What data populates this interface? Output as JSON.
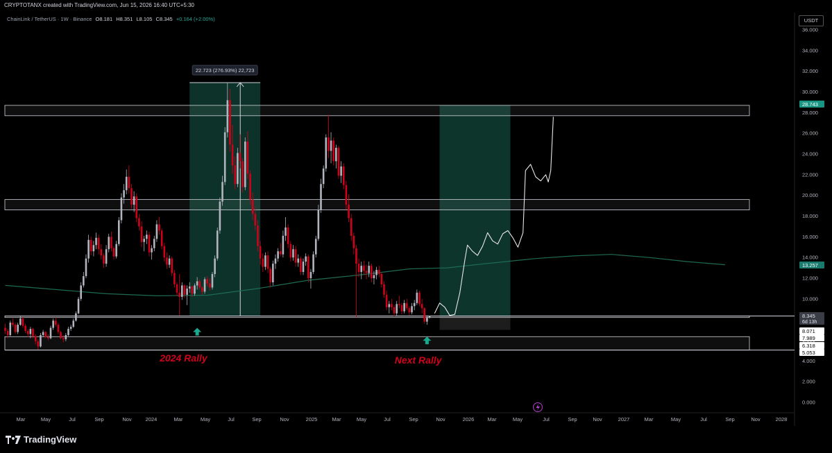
{
  "header": {
    "credit": "CRYPTOTANX created with TradingView.com, Jun 15, 2026 16:40 UTC+5:30"
  },
  "legend": {
    "symbol_line": "ChainLink / TetherUS · 1W · Binance",
    "open": "O8.181",
    "high": "H8.351",
    "low": "L8.105",
    "close": "C8.345",
    "change": "+0.164 (+2.00%)"
  },
  "currency_badge": "USDT",
  "colors": {
    "background": "#000000",
    "up_candle": "#b2b5be",
    "down_candle": "#d0021b",
    "ma_line": "#1e6b55",
    "zone_fill": "#0f3b30",
    "zone_box_stroke": "#d1d4dc",
    "rally_text": "#d0021b",
    "arrow": "#19a98e",
    "price_tag_green": "#199683",
    "price_tag_teal": "#1a7a6d",
    "forecast_path": "#e8e8e8"
  },
  "footer": {
    "brand": "TradingView",
    "logo": "tradingview-logo-icon"
  },
  "chart_data": {
    "type": "candlestick",
    "title": "ChainLink / TetherUS · 1W · Binance",
    "ylim": [
      0,
      36
    ],
    "y_ticks": [
      "36.000",
      "34.000",
      "32.000",
      "30.000",
      "28.000",
      "26.000",
      "24.000",
      "22.000",
      "20.000",
      "18.000",
      "16.000",
      "14.000",
      "12.000",
      "10.000",
      "8.000",
      "6.000",
      "4.000",
      "2.000",
      "0.000"
    ],
    "x_ticks": [
      "Mar",
      "May",
      "Jul",
      "Sep",
      "Nov",
      "2024",
      "Mar",
      "May",
      "Jul",
      "Sep",
      "Nov",
      "2025",
      "Mar",
      "May",
      "Jul",
      "Sep",
      "Nov",
      "2026",
      "Mar",
      "May",
      "Jul",
      "Sep",
      "Nov",
      "2027",
      "Mar",
      "May",
      "Jul",
      "Sep",
      "Nov",
      "2028"
    ],
    "grid": false,
    "ohlc": [
      [
        7.2,
        7.6,
        6.6,
        6.9
      ],
      [
        6.9,
        7.1,
        6.2,
        6.5
      ],
      [
        6.5,
        7.9,
        6.4,
        7.7
      ],
      [
        7.7,
        8.1,
        7.3,
        7.5
      ],
      [
        7.5,
        7.7,
        6.6,
        6.8
      ],
      [
        6.8,
        7.7,
        6.6,
        7.5
      ],
      [
        7.5,
        8.4,
        7.4,
        8.1
      ],
      [
        8.1,
        8.3,
        7.2,
        7.4
      ],
      [
        7.4,
        7.6,
        6.7,
        6.9
      ],
      [
        6.9,
        7.1,
        6.3,
        6.6
      ],
      [
        6.6,
        7.3,
        6.2,
        7.1
      ],
      [
        7.1,
        7.2,
        6.2,
        6.4
      ],
      [
        6.4,
        6.6,
        5.6,
        5.9
      ],
      [
        5.9,
        6.1,
        5.1,
        5.4
      ],
      [
        5.4,
        6.7,
        5.3,
        6.5
      ],
      [
        6.5,
        7.0,
        6.3,
        6.8
      ],
      [
        6.8,
        6.9,
        6.2,
        6.3
      ],
      [
        6.3,
        6.6,
        6.0,
        6.2
      ],
      [
        6.2,
        7.4,
        6.1,
        7.2
      ],
      [
        7.2,
        8.1,
        7.0,
        7.9
      ],
      [
        7.9,
        8.2,
        7.3,
        7.5
      ],
      [
        7.5,
        7.7,
        6.6,
        6.8
      ],
      [
        6.8,
        6.9,
        6.1,
        6.2
      ],
      [
        6.2,
        6.5,
        5.8,
        6.1
      ],
      [
        6.1,
        6.7,
        5.9,
        6.5
      ],
      [
        6.5,
        7.3,
        6.4,
        7.1
      ],
      [
        7.1,
        7.5,
        6.9,
        7.3
      ],
      [
        7.3,
        8.1,
        7.2,
        7.9
      ],
      [
        7.9,
        8.8,
        7.8,
        8.6
      ],
      [
        8.6,
        10.2,
        8.5,
        10.0
      ],
      [
        10.0,
        11.6,
        9.8,
        11.3
      ],
      [
        11.3,
        12.6,
        11.1,
        12.2
      ],
      [
        12.2,
        14.3,
        12.0,
        13.9
      ],
      [
        13.9,
        16.2,
        13.5,
        15.7
      ],
      [
        15.7,
        16.0,
        14.2,
        14.6
      ],
      [
        14.6,
        15.6,
        14.1,
        15.2
      ],
      [
        15.2,
        16.4,
        14.8,
        15.9
      ],
      [
        15.9,
        16.2,
        14.3,
        14.8
      ],
      [
        14.8,
        15.3,
        13.8,
        14.2
      ],
      [
        14.2,
        14.4,
        13.0,
        13.4
      ],
      [
        13.4,
        15.2,
        13.1,
        14.8
      ],
      [
        14.8,
        16.3,
        14.5,
        16.0
      ],
      [
        16.0,
        16.5,
        14.6,
        14.9
      ],
      [
        14.9,
        15.1,
        13.8,
        14.1
      ],
      [
        14.1,
        15.6,
        13.9,
        15.3
      ],
      [
        15.3,
        17.9,
        15.1,
        17.6
      ],
      [
        17.6,
        20.2,
        17.3,
        19.8
      ],
      [
        19.8,
        21.1,
        19.2,
        20.5
      ],
      [
        20.5,
        22.5,
        20.1,
        21.8
      ],
      [
        21.8,
        22.9,
        20.2,
        20.7
      ],
      [
        20.7,
        21.1,
        18.7,
        19.1
      ],
      [
        19.1,
        20.4,
        18.4,
        19.9
      ],
      [
        19.9,
        20.2,
        17.4,
        17.8
      ],
      [
        17.8,
        18.2,
        16.6,
        17.0
      ],
      [
        17.0,
        17.5,
        15.0,
        15.5
      ],
      [
        15.5,
        16.1,
        14.6,
        15.8
      ],
      [
        15.8,
        16.6,
        15.3,
        16.2
      ],
      [
        16.2,
        16.5,
        14.1,
        14.5
      ],
      [
        14.5,
        15.2,
        13.8,
        14.9
      ],
      [
        14.9,
        16.1,
        14.6,
        15.8
      ],
      [
        15.8,
        17.6,
        15.5,
        17.2
      ],
      [
        17.2,
        17.9,
        16.2,
        16.6
      ],
      [
        16.6,
        16.8,
        14.8,
        15.1
      ],
      [
        15.1,
        15.4,
        13.6,
        14.0
      ],
      [
        14.0,
        14.5,
        12.9,
        13.3
      ],
      [
        13.3,
        14.2,
        13.0,
        13.9
      ],
      [
        13.9,
        14.1,
        12.2,
        12.5
      ],
      [
        12.5,
        12.8,
        11.1,
        11.4
      ],
      [
        11.4,
        11.6,
        10.3,
        10.6
      ],
      [
        10.6,
        12.4,
        8.4,
        10.2
      ],
      [
        10.2,
        11.6,
        9.9,
        11.3
      ],
      [
        11.3,
        11.4,
        10.1,
        10.4
      ],
      [
        10.4,
        11.3,
        9.4,
        11.0
      ],
      [
        11.0,
        11.6,
        10.6,
        11.2
      ],
      [
        11.2,
        11.3,
        10.2,
        10.5
      ],
      [
        10.5,
        11.5,
        10.3,
        11.3
      ],
      [
        11.3,
        12.1,
        10.9,
        11.7
      ],
      [
        11.7,
        11.9,
        10.9,
        11.1
      ],
      [
        11.1,
        11.2,
        10.4,
        10.7
      ],
      [
        10.7,
        12.1,
        10.5,
        11.9
      ],
      [
        11.9,
        12.2,
        11.2,
        11.5
      ],
      [
        11.5,
        12.0,
        10.8,
        11.1
      ],
      [
        11.1,
        12.6,
        10.9,
        12.4
      ],
      [
        12.4,
        14.2,
        12.1,
        13.9
      ],
      [
        13.9,
        16.9,
        13.7,
        16.6
      ],
      [
        16.6,
        19.8,
        16.3,
        19.4
      ],
      [
        19.4,
        21.9,
        19.0,
        21.3
      ],
      [
        21.3,
        26.6,
        21.0,
        26.1
      ],
      [
        26.1,
        30.9,
        25.6,
        29.2
      ],
      [
        29.2,
        30.3,
        24.2,
        24.9
      ],
      [
        24.9,
        26.8,
        22.1,
        22.9
      ],
      [
        22.9,
        23.8,
        20.6,
        21.1
      ],
      [
        21.1,
        24.6,
        20.8,
        24.1
      ],
      [
        24.1,
        25.9,
        22.6,
        23.3
      ],
      [
        23.3,
        23.6,
        20.3,
        20.8
      ],
      [
        20.8,
        25.6,
        20.5,
        25.2
      ],
      [
        25.2,
        26.2,
        21.6,
        22.1
      ],
      [
        22.1,
        22.4,
        19.1,
        19.6
      ],
      [
        19.6,
        20.3,
        17.6,
        18.2
      ],
      [
        18.2,
        18.9,
        16.6,
        17.1
      ],
      [
        17.1,
        17.6,
        14.6,
        15.1
      ],
      [
        15.1,
        15.6,
        13.3,
        13.9
      ],
      [
        13.9,
        14.4,
        12.6,
        13.1
      ],
      [
        13.1,
        14.5,
        12.8,
        14.2
      ],
      [
        14.2,
        14.6,
        12.5,
        12.9
      ],
      [
        12.9,
        13.1,
        11.1,
        11.6
      ],
      [
        11.6,
        13.7,
        11.3,
        13.4
      ],
      [
        13.4,
        14.3,
        12.9,
        13.9
      ],
      [
        13.9,
        14.9,
        13.6,
        14.6
      ],
      [
        14.6,
        15.4,
        14.1,
        14.3
      ],
      [
        14.3,
        16.6,
        14.0,
        16.1
      ],
      [
        16.1,
        17.9,
        15.6,
        16.9
      ],
      [
        16.9,
        17.2,
        14.9,
        15.3
      ],
      [
        15.3,
        15.6,
        13.6,
        14.0
      ],
      [
        14.0,
        15.2,
        13.7,
        14.8
      ],
      [
        14.8,
        15.1,
        13.1,
        13.5
      ],
      [
        13.5,
        14.3,
        13.1,
        13.9
      ],
      [
        13.9,
        14.1,
        12.3,
        12.6
      ],
      [
        12.6,
        13.9,
        12.3,
        13.6
      ],
      [
        13.6,
        14.4,
        13.2,
        14.1
      ],
      [
        14.1,
        14.3,
        11.6,
        12.0
      ],
      [
        12.0,
        12.9,
        11.0,
        12.6
      ],
      [
        12.6,
        14.6,
        12.4,
        14.3
      ],
      [
        14.3,
        16.1,
        14.0,
        15.8
      ],
      [
        15.8,
        19.1,
        15.6,
        18.6
      ],
      [
        18.6,
        21.6,
        18.3,
        21.1
      ],
      [
        21.1,
        22.9,
        20.7,
        22.6
      ],
      [
        22.6,
        25.9,
        22.3,
        25.6
      ],
      [
        25.6,
        27.8,
        23.6,
        24.3
      ],
      [
        24.3,
        26.1,
        23.1,
        25.3
      ],
      [
        25.3,
        25.6,
        22.9,
        23.3
      ],
      [
        23.3,
        24.9,
        22.6,
        24.6
      ],
      [
        24.6,
        24.8,
        21.6,
        21.9
      ],
      [
        21.9,
        23.3,
        21.2,
        22.8
      ],
      [
        22.8,
        23.1,
        20.6,
        21.0
      ],
      [
        21.0,
        21.4,
        18.6,
        19.1
      ],
      [
        19.1,
        20.1,
        17.4,
        17.8
      ],
      [
        17.8,
        18.2,
        15.6,
        16.1
      ],
      [
        16.1,
        16.4,
        14.3,
        14.9
      ],
      [
        14.9,
        15.2,
        8.2,
        13.4
      ],
      [
        13.4,
        13.9,
        12.1,
        12.6
      ],
      [
        12.6,
        13.6,
        11.9,
        13.2
      ],
      [
        13.2,
        13.7,
        12.3,
        12.7
      ],
      [
        12.7,
        13.3,
        11.9,
        12.5
      ],
      [
        12.5,
        13.6,
        12.1,
        13.2
      ],
      [
        13.2,
        13.4,
        11.6,
        12.0
      ],
      [
        12.0,
        12.7,
        11.4,
        12.3
      ],
      [
        12.3,
        13.1,
        11.9,
        12.8
      ],
      [
        12.8,
        13.2,
        12.1,
        12.4
      ],
      [
        12.4,
        12.6,
        11.1,
        11.4
      ],
      [
        11.4,
        11.7,
        10.1,
        10.4
      ],
      [
        10.4,
        10.8,
        8.9,
        9.2
      ],
      [
        9.2,
        9.8,
        8.6,
        9.5
      ],
      [
        9.5,
        10.0,
        8.9,
        9.2
      ],
      [
        9.2,
        9.4,
        8.3,
        8.6
      ],
      [
        8.6,
        9.8,
        8.4,
        9.5
      ],
      [
        9.5,
        10.3,
        9.1,
        9.4
      ],
      [
        9.4,
        9.6,
        8.5,
        8.8
      ],
      [
        8.8,
        9.9,
        8.6,
        9.6
      ],
      [
        9.6,
        10.0,
        8.9,
        9.1
      ],
      [
        9.1,
        9.3,
        8.4,
        8.7
      ],
      [
        8.7,
        9.6,
        8.5,
        9.3
      ],
      [
        9.3,
        9.9,
        8.9,
        9.6
      ],
      [
        9.6,
        10.9,
        9.4,
        10.6
      ],
      [
        10.6,
        10.8,
        9.3,
        9.5
      ],
      [
        9.5,
        10.0,
        8.6,
        9.1
      ],
      [
        9.1,
        9.2,
        7.6,
        7.8
      ],
      [
        7.8,
        8.4,
        7.5,
        8.2
      ],
      [
        8.181,
        8.351,
        8.105,
        8.345
      ]
    ],
    "moving_average": [
      [
        0,
        11.3
      ],
      [
        20,
        10.9
      ],
      [
        40,
        10.5
      ],
      [
        60,
        10.3
      ],
      [
        80,
        10.35
      ],
      [
        100,
        11.0
      ],
      [
        120,
        11.8
      ],
      [
        140,
        12.3
      ],
      [
        160,
        12.9
      ],
      [
        175,
        13.0
      ],
      [
        190,
        13.4
      ],
      [
        210,
        13.9
      ],
      [
        225,
        14.15
      ],
      [
        240,
        14.3
      ],
      [
        255,
        14.0
      ],
      [
        270,
        13.6
      ],
      [
        285,
        13.3
      ]
    ],
    "price_zones": [
      {
        "low": 27.7,
        "high": 28.7
      },
      {
        "low": 18.6,
        "high": 19.6
      },
      {
        "low": 8.2,
        "high": 8.35
      },
      {
        "low": 5.05,
        "high": 6.35
      }
    ],
    "measure_box_2024": {
      "from_bar": 73,
      "to_bar": 101,
      "low": 8.35,
      "high": 30.9,
      "label": "22.723 (276.93%) 22,723"
    },
    "forecast_zone": {
      "from_bar": 172,
      "to_bar": 200,
      "low": 7.0,
      "high": 28.74
    },
    "forecast_path": [
      [
        170,
        8.6
      ],
      [
        172,
        9.6
      ],
      [
        174,
        9.2
      ],
      [
        176,
        8.4
      ],
      [
        178,
        8.5
      ],
      [
        180,
        10.6
      ],
      [
        182,
        13.8
      ],
      [
        183,
        15.2
      ],
      [
        185,
        14.6
      ],
      [
        187,
        14.2
      ],
      [
        189,
        15.1
      ],
      [
        191,
        16.4
      ],
      [
        193,
        15.6
      ],
      [
        195,
        15.3
      ],
      [
        197,
        16.3
      ],
      [
        199,
        16.6
      ],
      [
        201,
        15.9
      ],
      [
        203,
        15.0
      ],
      [
        205,
        16.4
      ],
      [
        206,
        22.4
      ],
      [
        208,
        23.0
      ],
      [
        210,
        21.8
      ],
      [
        212,
        21.4
      ],
      [
        214,
        22.0
      ],
      [
        215,
        21.3
      ],
      [
        216,
        22.4
      ],
      [
        217,
        27.6
      ]
    ],
    "annotations": [
      {
        "text": "2024 Rally",
        "bar": 73
      },
      {
        "text": "Next Rally",
        "bar": 166
      }
    ],
    "up_arrows": [
      {
        "bar": 76,
        "value": 7.2
      },
      {
        "bar": 167,
        "value": 6.35
      }
    ],
    "price_tags": [
      {
        "value": 28.743,
        "label": "28.743",
        "style": "green"
      },
      {
        "value": 13.257,
        "label": "13.257",
        "style": "teal"
      },
      {
        "value": 8.345,
        "label": "8.345",
        "sub": "6d 13h",
        "style": "grey"
      },
      {
        "value": 8.071,
        "label": "8.071",
        "style": "white"
      },
      {
        "value": 7.989,
        "label": "7.989",
        "style": "white"
      },
      {
        "value": 6.318,
        "label": "6.318",
        "style": "white"
      },
      {
        "value": 5.053,
        "label": "5.053",
        "style": "white"
      }
    ]
  }
}
